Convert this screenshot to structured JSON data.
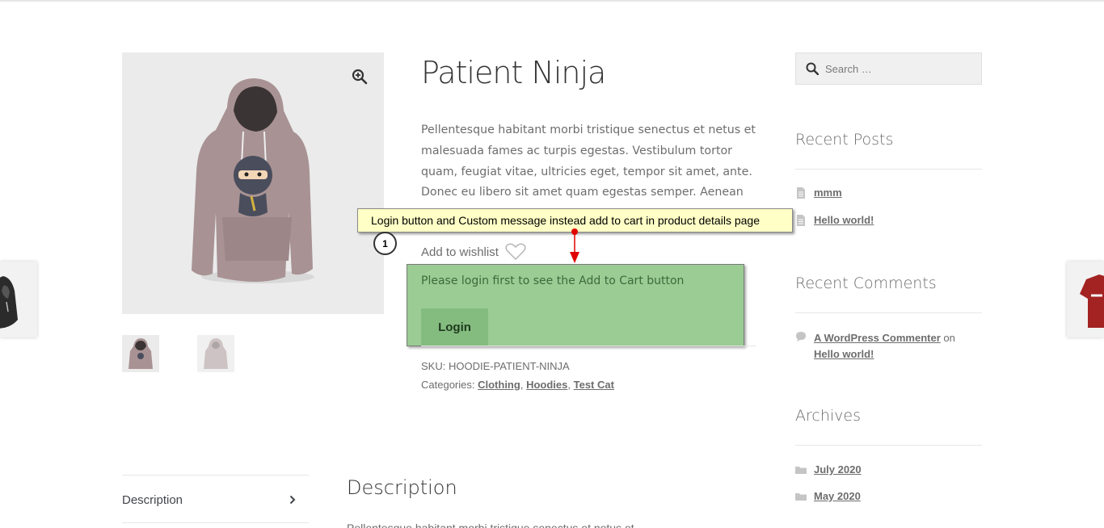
{
  "product": {
    "title": "Patient Ninja",
    "description": "Pellentesque habitant morbi tristique senectus et netus et malesuada fames ac turpis egestas. Vestibulum tortor quam, feugiat vitae, ultricies eget, tempor sit amet, ante. Donec eu libero sit amet quam egestas semper. Aenean ultricies mi vitae",
    "wishlist_label": "Add to wishlist",
    "login_message": "Please login first to see the Add to Cart button",
    "login_button": "Login",
    "sku_label": "SKU:",
    "sku_value": "HOODIE-PATIENT-NINJA",
    "categories_label": "Categories:",
    "categories": [
      "Clothing",
      "Hoodies",
      "Test Cat"
    ],
    "category_separator": ","
  },
  "annotation": {
    "callout_text": "Login button and Custom message instead add to cart in product details page",
    "step_number": "1",
    "arrow_color": "#e00000"
  },
  "sidebar": {
    "search_placeholder": "Search …",
    "recent_posts_title": "Recent Posts",
    "recent_posts": [
      "mmm",
      "Hello world!"
    ],
    "recent_comments_title": "Recent Comments",
    "comment": {
      "author": "A WordPress Commenter",
      "connector": "on",
      "post": "Hello world!"
    },
    "archives_title": "Archives",
    "archives": [
      "July 2020",
      "May 2020"
    ]
  },
  "tabs": {
    "description_tab": "Description",
    "description_heading": "Description",
    "description_partial": "Pellentesque habitant morbi tristique senectus et netus et"
  },
  "icons": {
    "zoom": "magnifier-plus-icon",
    "heart": "heart-icon",
    "search": "search-icon",
    "document": "document-icon",
    "comment": "speech-bubble-icon",
    "folder": "folder-icon",
    "chevron": "chevron-right-icon"
  },
  "colors": {
    "login_panel": "#9acc94",
    "login_button": "#84bc7f",
    "callout_bg": "#ffffc6",
    "hoodie": "#a89294"
  }
}
